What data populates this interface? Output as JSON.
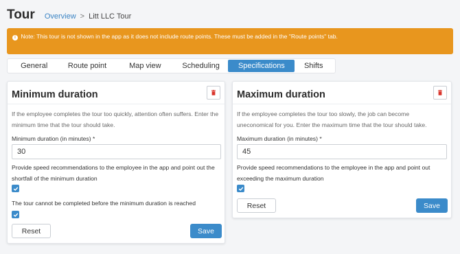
{
  "header": {
    "title": "Tour",
    "breadcrumb": {
      "overview": "Overview",
      "separator": ">",
      "current": "Litt LLC Tour"
    }
  },
  "alert": {
    "text": "Note: This tour is not shown in the app as it does not include route points. These must be added in the \"Route points\" tab.",
    "color": "#e8961e"
  },
  "tabs": [
    {
      "label": "General",
      "active": false
    },
    {
      "label": "Route point",
      "active": false
    },
    {
      "label": "Map view",
      "active": false
    },
    {
      "label": "Scheduling",
      "active": false
    },
    {
      "label": "Specifications",
      "active": true
    },
    {
      "label": "Shifts",
      "active": false
    }
  ],
  "min_card": {
    "title": "Minimum duration",
    "description": "If the employee completes the tour too quickly, attention often suffers. Enter the minimum time that the tour should take.",
    "field_label": "Minimum duration (in minutes) *",
    "field_value": "30",
    "option1": "Provide speed recommendations to the employee in the app and point out the shortfall of the minimum duration",
    "option1_checked": true,
    "option2": "The tour cannot be completed before the minimum duration is reached",
    "option2_checked": true,
    "reset_label": "Reset",
    "save_label": "Save"
  },
  "max_card": {
    "title": "Maximum duration",
    "description": "If the employee completes the tour too slowly, the job can become uneconomical for you. Enter the maximum time that the tour should take.",
    "field_label": "Maximum duration (in minutes) *",
    "field_value": "45",
    "option1": "Provide speed recommendations to the employee in the app and point out exceeding the maximum duration",
    "option1_checked": true,
    "reset_label": "Reset",
    "save_label": "Save"
  },
  "colors": {
    "accent": "#3b8bca",
    "delete_icon": "#d9342b",
    "warning": "#e8961e"
  }
}
